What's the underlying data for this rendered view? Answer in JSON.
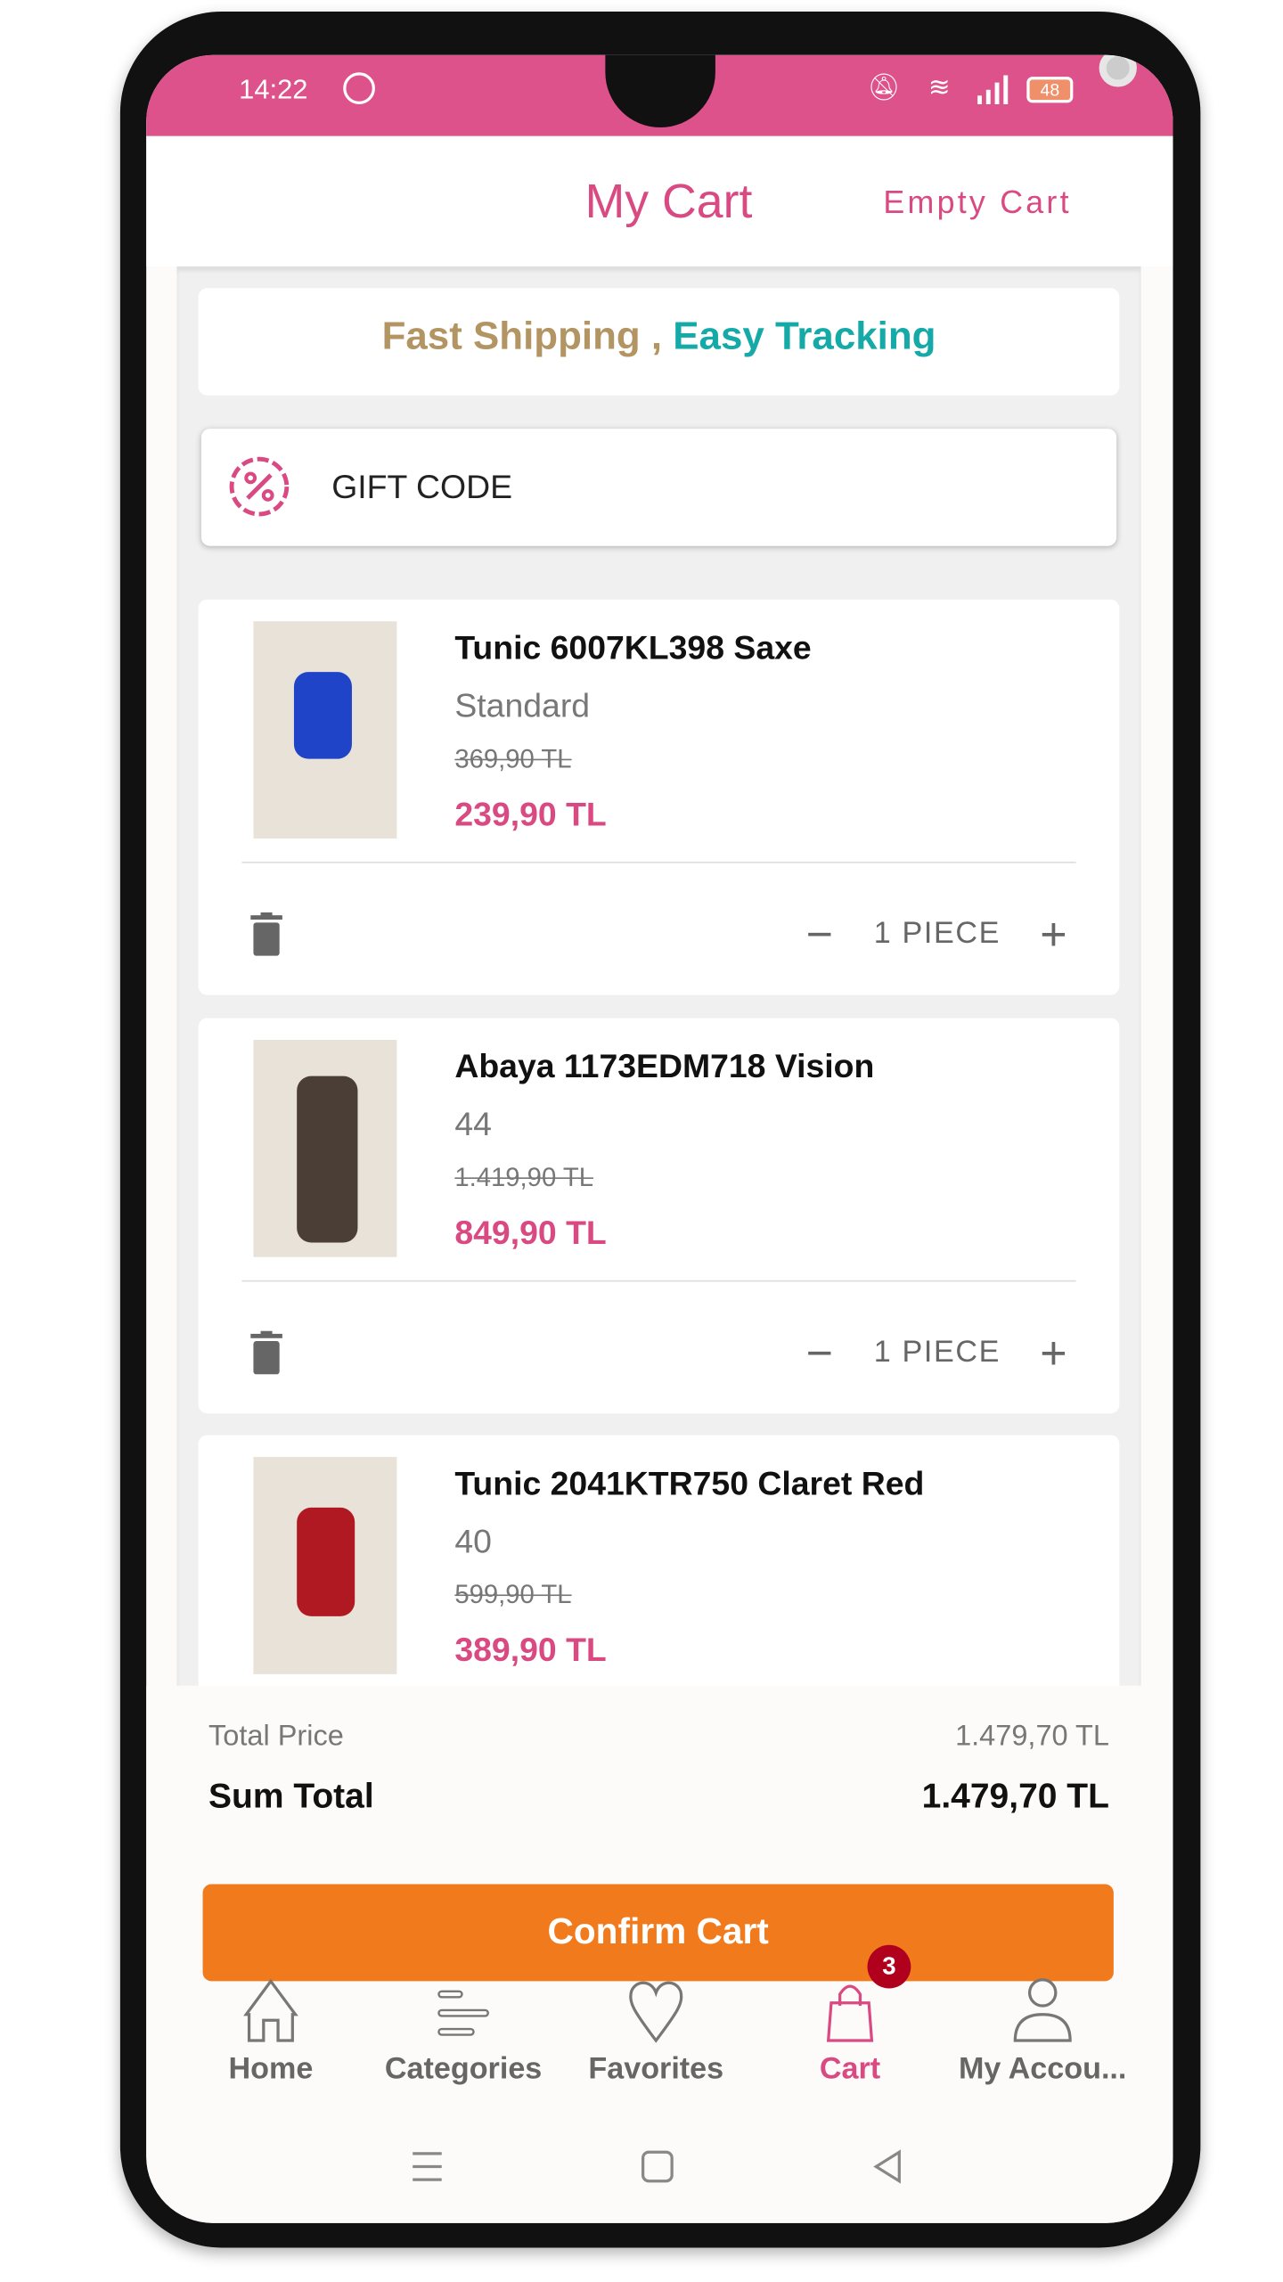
{
  "status_bar": {
    "time": "14:22",
    "battery": "48"
  },
  "header": {
    "title": "My Cart",
    "empty_cart": "Empty Cart"
  },
  "banner": {
    "part1": "Fast Shipping ,",
    "part2": "Easy Tracking"
  },
  "gift_code": {
    "label": "GIFT CODE"
  },
  "items": [
    {
      "name": "Tunic 6007KL398 Saxe",
      "variant": "Standard",
      "old_price": "369,90 TL",
      "price": "239,90 TL",
      "qty": "1 PIECE",
      "color": "#1f44c8"
    },
    {
      "name": "Abaya 1173EDM718 Vision",
      "variant": "44",
      "old_price": "1.419,90 TL",
      "price": "849,90 TL",
      "qty": "1 PIECE",
      "color": "#4a3e36"
    },
    {
      "name": "Tunic 2041KTR750 Claret Red",
      "variant": "40",
      "old_price": "599,90 TL",
      "price": "389,90 TL",
      "color": "#b01822"
    }
  ],
  "summary": {
    "total_price_label": "Total Price",
    "total_price": "1.479,70 TL",
    "sum_total_label": "Sum Total",
    "sum_total": "1.479,70 TL",
    "confirm": "Confirm Cart"
  },
  "nav": [
    {
      "label": "Home",
      "icon": "home-icon"
    },
    {
      "label": "Categories",
      "icon": "categories-icon"
    },
    {
      "label": "Favorites",
      "icon": "heart-icon"
    },
    {
      "label": "Cart",
      "icon": "bag-icon",
      "badge": "3",
      "active": true
    },
    {
      "label": "My Accou...",
      "icon": "user-icon"
    }
  ],
  "colors": {
    "brand": "#de528c",
    "accent_pink": "#d94a83",
    "confirm": "#f07a1c",
    "gold": "#b39563",
    "teal": "#15aaa8",
    "badge": "#b0001e"
  }
}
